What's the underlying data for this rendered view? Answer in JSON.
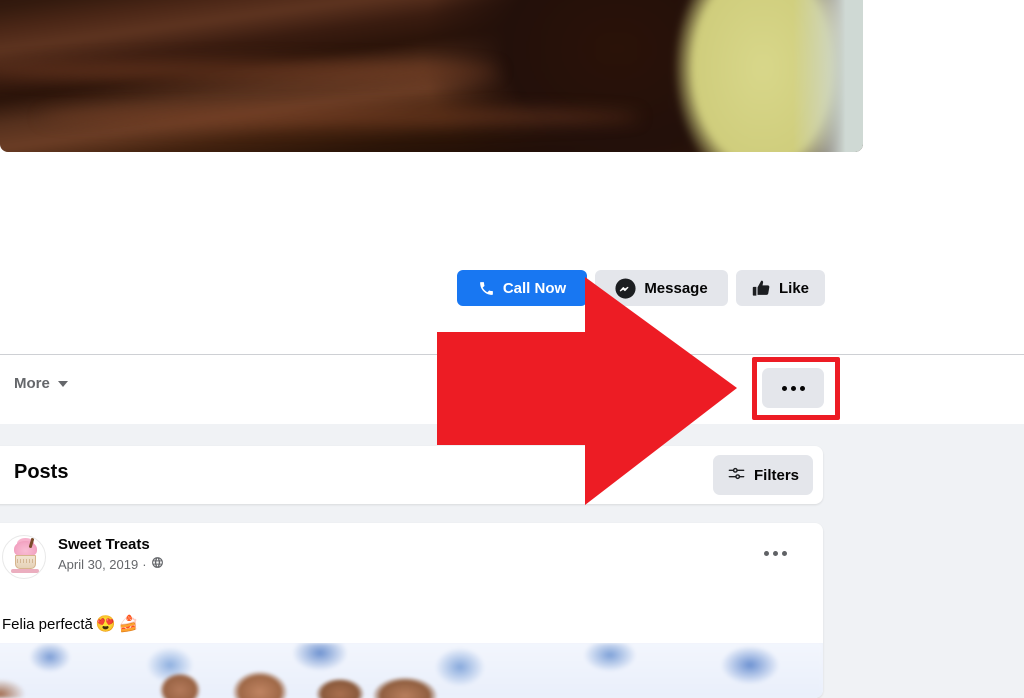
{
  "app": "facebook-page",
  "colors": {
    "primary": "#1877f2",
    "button_secondary": "#e4e6eb",
    "text_primary": "#050505",
    "text_secondary": "#65676b",
    "feed_background": "#f0f2f5",
    "highlight_red": "#ed1c24",
    "arrow_red": "#ed1c24"
  },
  "cover": {
    "alt": "chocolate-cake-cover-photo"
  },
  "page_actions": {
    "call_now": {
      "label": "Call Now",
      "icon": "phone-icon"
    },
    "message": {
      "label": "Message",
      "icon": "messenger-icon"
    },
    "like": {
      "label": "Like",
      "icon": "thumbs-up-icon"
    }
  },
  "navbar": {
    "more": {
      "label": "More",
      "icon": "chevron-down-icon"
    },
    "overflow": {
      "label": "...",
      "icon": "ellipsis-icon",
      "highlighted": true
    }
  },
  "feed": {
    "section_title": "Posts",
    "filters": {
      "label": "Filters",
      "icon": "sliders-icon"
    },
    "post": {
      "author": "Sweet Treats",
      "date": "April 30, 2019",
      "separator": "·",
      "audience_icon": "globe-icon",
      "menu_icon": "ellipsis-icon",
      "text": "Felia perfectă",
      "emoji_1": "😍",
      "emoji_2": "🍰",
      "photo_alt": "chocolate-cake-on-blue-floral-plate"
    }
  },
  "annotation": {
    "arrow": {
      "type": "right-pointing-arrow",
      "color": "#ed1c24",
      "points_to": "overflow-menu-button"
    },
    "highlight": {
      "type": "rectangle-outline",
      "color": "#ed1c24",
      "target": "overflow-menu-button"
    }
  }
}
